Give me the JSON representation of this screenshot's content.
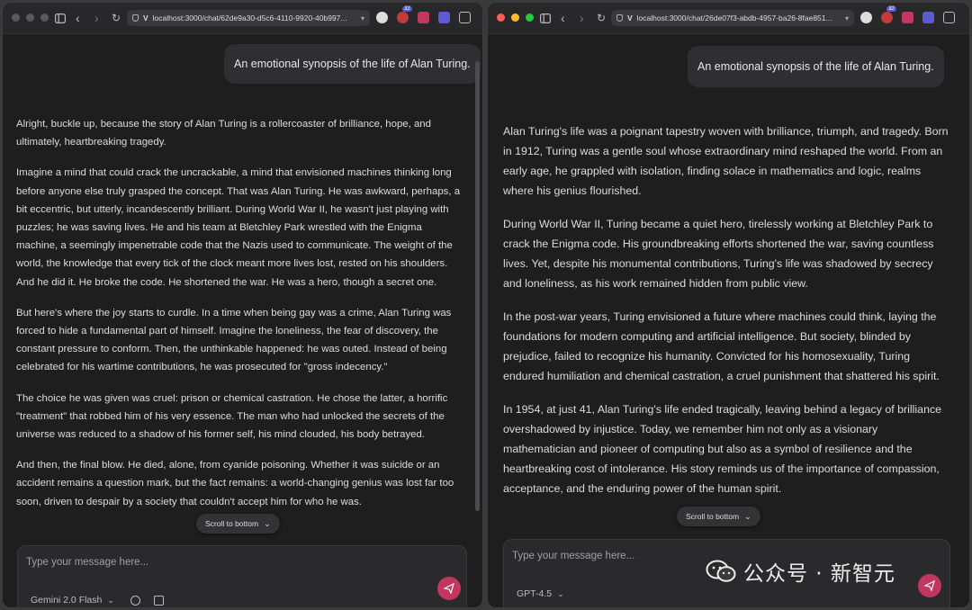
{
  "left": {
    "url": "localhost:3000/chat/62de9a30-d5c6-4110-9920-40b997...",
    "ext_badge": "32",
    "user_message": "An emotional synopsis of the life of Alan Turing.",
    "reply": [
      "Alright, buckle up, because the story of Alan Turing is a rollercoaster of brilliance, hope, and ultimately, heartbreaking tragedy.",
      "Imagine a mind that could crack the uncrackable, a mind that envisioned machines thinking long before anyone else truly grasped the concept. That was Alan Turing. He was awkward, perhaps, a bit eccentric, but utterly, incandescently brilliant. During World War II, he wasn't just playing with puzzles; he was saving lives. He and his team at Bletchley Park wrestled with the Enigma machine, a seemingly impenetrable code that the Nazis used to communicate. The weight of the world, the knowledge that every tick of the clock meant more lives lost, rested on his shoulders. And he did it. He broke the code. He shortened the war. He was a hero, though a secret one.",
      "But here's where the joy starts to curdle. In a time when being gay was a crime, Alan Turing was forced to hide a fundamental part of himself. Imagine the loneliness, the fear of discovery, the constant pressure to conform. Then, the unthinkable happened: he was outed. Instead of being celebrated for his wartime contributions, he was prosecuted for \"gross indecency.\"",
      "The choice he was given was cruel: prison or chemical castration. He chose the latter, a horrific \"treatment\" that robbed him of his very essence. The man who had unlocked the secrets of the universe was reduced to a shadow of his former self, his mind clouded, his body betrayed.",
      "And then, the final blow. He died, alone, from cyanide poisoning. Whether it was suicide or an accident remains a question mark, but the fact remains: a world-changing genius was lost far too soon, driven to despair by a society that couldn't accept him for who he was."
    ],
    "scroll_label": "Scroll to bottom",
    "placeholder": "Type your message here...",
    "model": "Gemini 2.0 Flash"
  },
  "right": {
    "url": "localhost:3000/chat/26de07f3-abdb-4957-ba26-8fae851...",
    "ext_badge": "32",
    "user_message": "An emotional synopsis of the life of Alan Turing.",
    "reply": [
      "Alan Turing's life was a poignant tapestry woven with brilliance, triumph, and tragedy. Born in 1912, Turing was a gentle soul whose extraordinary mind reshaped the world. From an early age, he grappled with isolation, finding solace in mathematics and logic, realms where his genius flourished.",
      "During World War II, Turing became a quiet hero, tirelessly working at Bletchley Park to crack the Enigma code. His groundbreaking efforts shortened the war, saving countless lives. Yet, despite his monumental contributions, Turing's life was shadowed by secrecy and loneliness, as his work remained hidden from public view.",
      "In the post-war years, Turing envisioned a future where machines could think, laying the foundations for modern computing and artificial intelligence. But society, blinded by prejudice, failed to recognize his humanity. Convicted for his homosexuality, Turing endured humiliation and chemical castration, a cruel punishment that shattered his spirit.",
      "In 1954, at just 41, Alan Turing's life ended tragically, leaving behind a legacy of brilliance overshadowed by injustice. Today, we remember him not only as a visionary mathematician and pioneer of computing but also as a symbol of resilience and the heartbreaking cost of intolerance. His story reminds us of the importance of compassion, acceptance, and the enduring power of the human spirit."
    ],
    "scroll_label": "Scroll to bottom",
    "placeholder": "Type your message here...",
    "model": "GPT-4.5"
  },
  "watermark": {
    "text": "公众号 · 新智元"
  },
  "colors": {
    "send_button": "#c2375f",
    "window_bg": "#1e1e1f",
    "bubble_bg": "#2f2f31"
  },
  "icons": [
    "sidebar-icon",
    "back-icon",
    "forward-icon",
    "reload-icon",
    "shield-icon",
    "chevron-down-icon",
    "globe-icon",
    "image-icon",
    "send-icon",
    "puzzle-icon",
    "wechat-icon"
  ]
}
